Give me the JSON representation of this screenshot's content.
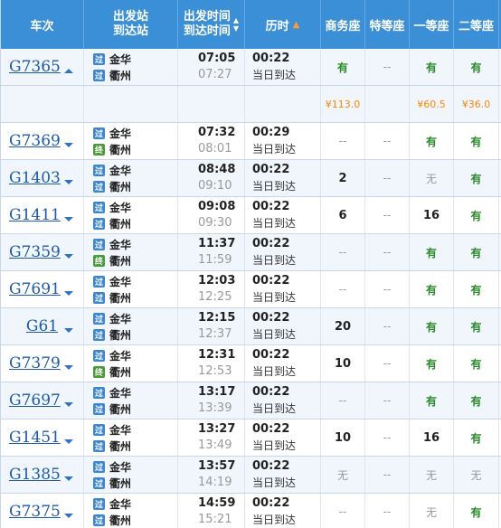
{
  "header": {
    "train_label": "车次",
    "station_label_1": "出发站",
    "station_label_2": "到达站",
    "time_label_1": "出发时间",
    "time_label_2": "到达时间",
    "duration_label": "历时",
    "business_label": "商务座",
    "premium_label": "特等座",
    "first_label": "一等座",
    "second_label": "二等座"
  },
  "icons": {
    "sort_up": "▲",
    "sort_down": "▼"
  },
  "tags": {
    "pass": "过",
    "end": "终"
  },
  "rows": [
    {
      "train": "G7365",
      "expanded": true,
      "from_tag": "pass",
      "from": "金华",
      "to_tag": "pass",
      "to": "衢州",
      "dep": "07:05",
      "arr": "07:27",
      "dur": "00:22",
      "arrive_day": "当日到达",
      "business": "有",
      "premium": "--",
      "first": "有",
      "second": "有"
    },
    {
      "train": "G7369",
      "from_tag": "pass",
      "from": "金华",
      "to_tag": "end",
      "to": "衢州",
      "dep": "07:32",
      "arr": "08:01",
      "dur": "00:29",
      "arrive_day": "当日到达",
      "business": "--",
      "premium": "--",
      "first": "有",
      "second": "有"
    },
    {
      "train": "G1403",
      "from_tag": "pass",
      "from": "金华",
      "to_tag": "pass",
      "to": "衢州",
      "dep": "08:48",
      "arr": "09:10",
      "dur": "00:22",
      "arrive_day": "当日到达",
      "business": "2",
      "premium": "--",
      "first": "无",
      "second": "有"
    },
    {
      "train": "G1411",
      "from_tag": "pass",
      "from": "金华",
      "to_tag": "pass",
      "to": "衢州",
      "dep": "09:08",
      "arr": "09:30",
      "dur": "00:22",
      "arrive_day": "当日到达",
      "business": "6",
      "premium": "--",
      "first": "16",
      "second": "有"
    },
    {
      "train": "G7359",
      "from_tag": "pass",
      "from": "金华",
      "to_tag": "end",
      "to": "衢州",
      "dep": "11:37",
      "arr": "11:59",
      "dur": "00:22",
      "arrive_day": "当日到达",
      "business": "--",
      "premium": "--",
      "first": "有",
      "second": "有"
    },
    {
      "train": "G7691",
      "from_tag": "pass",
      "from": "金华",
      "to_tag": "pass",
      "to": "衢州",
      "dep": "12:03",
      "arr": "12:25",
      "dur": "00:22",
      "arrive_day": "当日到达",
      "business": "--",
      "premium": "--",
      "first": "有",
      "second": "有"
    },
    {
      "train": "G61",
      "centered": true,
      "from_tag": "pass",
      "from": "金华",
      "to_tag": "pass",
      "to": "衢州",
      "dep": "12:15",
      "arr": "12:37",
      "dur": "00:22",
      "arrive_day": "当日到达",
      "business": "20",
      "premium": "--",
      "first": "有",
      "second": "有"
    },
    {
      "train": "G7379",
      "from_tag": "pass",
      "from": "金华",
      "to_tag": "end",
      "to": "衢州",
      "dep": "12:31",
      "arr": "12:53",
      "dur": "00:22",
      "arrive_day": "当日到达",
      "business": "10",
      "premium": "--",
      "first": "有",
      "second": "有"
    },
    {
      "train": "G7697",
      "from_tag": "pass",
      "from": "金华",
      "to_tag": "pass",
      "to": "衢州",
      "dep": "13:17",
      "arr": "13:39",
      "dur": "00:22",
      "arrive_day": "当日到达",
      "business": "--",
      "premium": "--",
      "first": "有",
      "second": "有"
    },
    {
      "train": "G1451",
      "from_tag": "pass",
      "from": "金华",
      "to_tag": "pass",
      "to": "衢州",
      "dep": "13:27",
      "arr": "13:49",
      "dur": "00:22",
      "arrive_day": "当日到达",
      "business": "10",
      "premium": "--",
      "first": "16",
      "second": "有"
    },
    {
      "train": "G1385",
      "from_tag": "pass",
      "from": "金华",
      "to_tag": "pass",
      "to": "衢州",
      "dep": "13:57",
      "arr": "14:19",
      "dur": "00:22",
      "arrive_day": "当日到达",
      "business": "无",
      "premium": "--",
      "first": "无",
      "second": "无"
    },
    {
      "train": "G7375",
      "from_tag": "pass",
      "from": "金华",
      "to_tag": "pass",
      "to": "衢州",
      "dep": "14:59",
      "arr": "15:21",
      "dur": "00:22",
      "arrive_day": "当日到达",
      "business": "--",
      "premium": "--",
      "first": "无",
      "second": "有"
    }
  ],
  "price_row": {
    "business": "¥113.0",
    "premium": "",
    "first": "¥60.5",
    "second": "¥36.0"
  },
  "colors": {
    "header_bg": "#3b8fd6",
    "available": "#2a8b2a",
    "price": "#ff8800",
    "link": "#1d5aa8"
  }
}
